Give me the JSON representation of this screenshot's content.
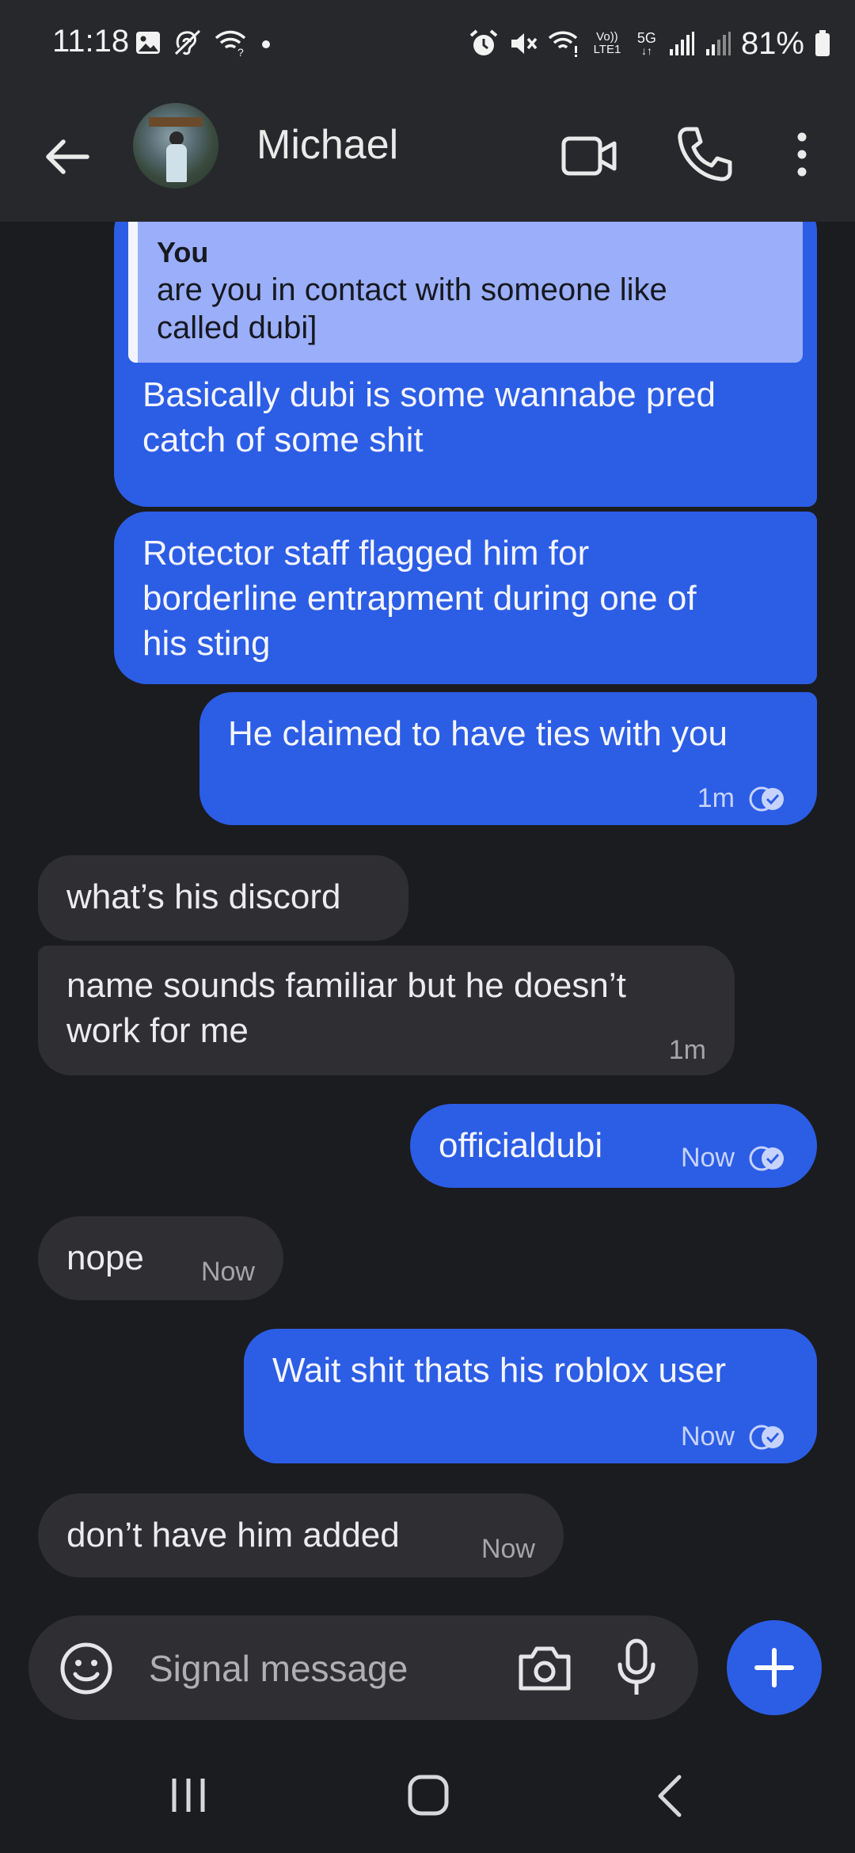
{
  "status_bar": {
    "time": "11:18",
    "battery": "81%",
    "network": "5G",
    "lte": "Vo)) LTE1",
    "icons": [
      "gallery-icon",
      "hearing-icon",
      "wifi-icon",
      "dot-icon",
      "alarm-icon",
      "mute-icon",
      "wifi-calling-icon",
      "signal-icon",
      "signal-icon",
      "battery-icon"
    ]
  },
  "header": {
    "contact_name": "Michael",
    "icons": [
      "back-arrow-icon",
      "avatar",
      "video-call-icon",
      "phone-icon",
      "more-vert-icon"
    ]
  },
  "messages": [
    {
      "direction": "outgoing",
      "quote": {
        "author": "You",
        "text_line1": "are you in contact with someone like",
        "text_line2": "called dubi]"
      },
      "lines": [
        "Basically dubi is some wannabe pred",
        "catch of some shit"
      ]
    },
    {
      "direction": "outgoing",
      "lines": [
        "Rotector staff flagged him for",
        "borderline entrapment during one of",
        "his sting"
      ]
    },
    {
      "direction": "outgoing",
      "lines": [
        "He claimed to have ties with you"
      ],
      "time": "1m",
      "delivered": true
    },
    {
      "direction": "incoming",
      "lines": [
        "what’s his discord"
      ]
    },
    {
      "direction": "incoming",
      "lines": [
        "name sounds familiar but he doesn’t",
        "work for me"
      ],
      "time": "1m"
    },
    {
      "direction": "outgoing",
      "lines": [
        "officialdubi"
      ],
      "time": "Now",
      "delivered": true
    },
    {
      "direction": "incoming",
      "lines": [
        "nope"
      ],
      "time": "Now"
    },
    {
      "direction": "outgoing",
      "lines": [
        "Wait shit thats his roblox user"
      ],
      "time": "Now",
      "delivered": true
    },
    {
      "direction": "incoming",
      "lines": [
        "don’t have him added"
      ],
      "time": "Now"
    }
  ],
  "compose": {
    "placeholder": "Signal message",
    "icons": [
      "emoji-icon",
      "camera-icon",
      "microphone-icon",
      "plus-icon"
    ]
  },
  "colors": {
    "outgoing_bubble": "#2c5de5",
    "incoming_bubble": "#2f2f33",
    "background": "#1b1c1f",
    "header": "#27282c",
    "quote": "#9aaefa"
  }
}
